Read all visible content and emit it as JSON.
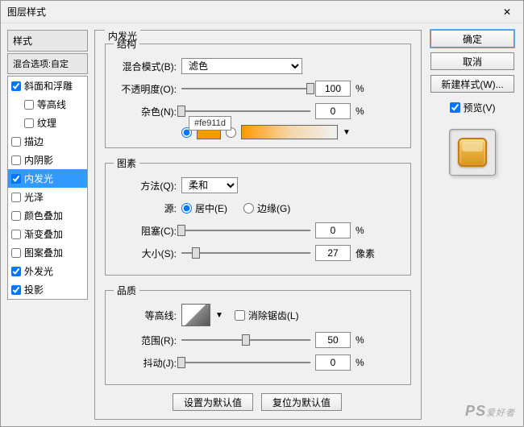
{
  "dialog": {
    "title": "图层样式"
  },
  "left": {
    "styles_header": "样式",
    "blend_opts": "混合选项:自定",
    "items": [
      {
        "label": "斜面和浮雕",
        "checked": true,
        "indent": false
      },
      {
        "label": "等高线",
        "checked": false,
        "indent": true
      },
      {
        "label": "纹理",
        "checked": false,
        "indent": true
      },
      {
        "label": "描边",
        "checked": false,
        "indent": false
      },
      {
        "label": "内阴影",
        "checked": false,
        "indent": false
      },
      {
        "label": "内发光",
        "checked": true,
        "indent": false,
        "selected": true
      },
      {
        "label": "光泽",
        "checked": false,
        "indent": false
      },
      {
        "label": "颜色叠加",
        "checked": false,
        "indent": false
      },
      {
        "label": "渐变叠加",
        "checked": false,
        "indent": false
      },
      {
        "label": "图案叠加",
        "checked": false,
        "indent": false
      },
      {
        "label": "外发光",
        "checked": true,
        "indent": false
      },
      {
        "label": "投影",
        "checked": true,
        "indent": false
      }
    ]
  },
  "center": {
    "title": "内发光",
    "structure": {
      "legend": "结构",
      "blend_mode_label": "混合模式(B):",
      "blend_mode_value": "滤色",
      "opacity_label": "不透明度(O):",
      "opacity_value": "100",
      "noise_label": "杂色(N):",
      "noise_value": "0",
      "percent": "%",
      "color_hex": "#fe911d"
    },
    "elements": {
      "legend": "图素",
      "technique_label": "方法(Q):",
      "technique_value": "柔和",
      "source_label": "源:",
      "center_label": "居中(E)",
      "edge_label": "边缘(G)",
      "choke_label": "阻塞(C):",
      "choke_value": "0",
      "size_label": "大小(S):",
      "size_value": "27",
      "px": "像素",
      "percent": "%"
    },
    "quality": {
      "legend": "品质",
      "contour_label": "等高线:",
      "antialias_label": "消除锯齿(L)",
      "range_label": "范围(R):",
      "range_value": "50",
      "jitter_label": "抖动(J):",
      "jitter_value": "0",
      "percent": "%"
    },
    "buttons": {
      "make_default": "设置为默认值",
      "reset_default": "复位为默认值"
    }
  },
  "right": {
    "ok": "确定",
    "cancel": "取消",
    "new_style": "新建样式(W)...",
    "preview": "预览(V)"
  },
  "watermark": {
    "main": "PS",
    "sub": "爱好者"
  }
}
